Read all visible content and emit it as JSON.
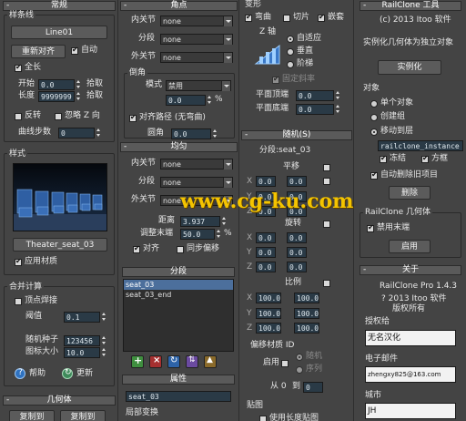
{
  "col1": {
    "header": "常规",
    "spline_group": "样条线",
    "spline_btn": "Line01",
    "reset_btn": "重新对齐",
    "auto_label": "自动",
    "full_length": "全长",
    "start_label": "开始",
    "start_value": "0.0",
    "length_label": "长度",
    "length_value": "9999999",
    "pick": "拾取",
    "reverse": "反转",
    "ignore_z": "忽略 Z 向",
    "curve_steps_label": "曲线步数",
    "curve_steps_value": "0",
    "style_group": "样式",
    "style_name": "Theater_seat_03",
    "apply_material": "应用材质",
    "merge_group": "合并计算",
    "vertex_weld": "顶点焊接",
    "threshold_label": "阈值",
    "threshold_value": "0.1",
    "random_seed_label": "随机种子",
    "random_seed_value": "123456",
    "icon_size_label": "图标大小",
    "icon_size_value": "10.0",
    "help": "帮助",
    "update": "更新",
    "geometry_header": "几何体",
    "copy1": "复制到",
    "copy2": "复制到"
  },
  "col2": {
    "corner_header": "角点",
    "inner": "内关节",
    "segment": "分段",
    "outer": "外关节",
    "none": "none",
    "bevel_group": "倒角",
    "mode_label": "模式",
    "mode_value": "禁用",
    "percent_value": "0.0",
    "percent_unit": "%",
    "align_path": "对齐路径 (无弯曲)",
    "fillet_label": "圆角",
    "fillet_value": "0.0",
    "even_header": "均匀",
    "distance_label": "距离",
    "distance_value": "3.937",
    "adjust_label": "调整末端",
    "adjust_value": "50.0",
    "align_label": "对齐",
    "sync_offset": "同步偏移",
    "segments_header": "分段",
    "list": [
      "seat_03",
      "seat_03_end"
    ],
    "props_header": "属性",
    "props_value": "seat_03",
    "local_transform": "局部变换"
  },
  "col3": {
    "deform_header": "变形",
    "bend": "弯曲",
    "slice": "切片",
    "clip": "嵌套",
    "z_axis": "Z 轴",
    "adaptive": "自适应",
    "vertical": "垂直",
    "stairs": "阶梯",
    "fixed_slope": "固定斜率",
    "flat_top": "平面顶端",
    "flat_top_value": "0.0",
    "flat_bottom": "平面底端",
    "flat_bottom_value": "0.0",
    "random_header": "随机(S)",
    "segment_title": "分段:seat_03",
    "translate": "平移",
    "rotate": "旋转",
    "scale": "比例",
    "x": "X",
    "y": "Y",
    "z": "Z",
    "zero": "0.0",
    "hundred": "100.0",
    "offset_mat_label": "偏移材质 ID",
    "enable": "启用",
    "random": "随机",
    "sequence": "序列",
    "range_from": "从 0",
    "range_to": "到",
    "range_value": "0",
    "map_label": "贴图",
    "map_check": "使用长度贴图"
  },
  "col4": {
    "tool_header": "RailClone 工具",
    "copyright": "(c) 2013 Itoo 软件",
    "instance_desc": "实例化几何体为独立对象",
    "instance_btn": "实例化",
    "object_label": "对象",
    "single_object": "单个对象",
    "create_group": "创建组",
    "move_to": "移动到层",
    "layer_value": "railclone_instance",
    "freeze": "冻结",
    "box": "方框",
    "auto_delete": "自动删除旧项目",
    "delete_btn": "删除",
    "geom_header": "RailClone 几何体",
    "disable_render": "禁用末端",
    "enable_btn": "启用",
    "about_header": "关于",
    "version": "RailClone Pro 1.4.3",
    "copyright2": "? 2013 Itoo 软件",
    "rights": "版权所有",
    "license_label": "授权给",
    "license_value": "无名汉化",
    "email_label": "电子邮件",
    "email_value": "zhengxy825@163.com",
    "city_label": "城市",
    "city_value": "JH"
  },
  "watermark": "www.cg-ku.com"
}
